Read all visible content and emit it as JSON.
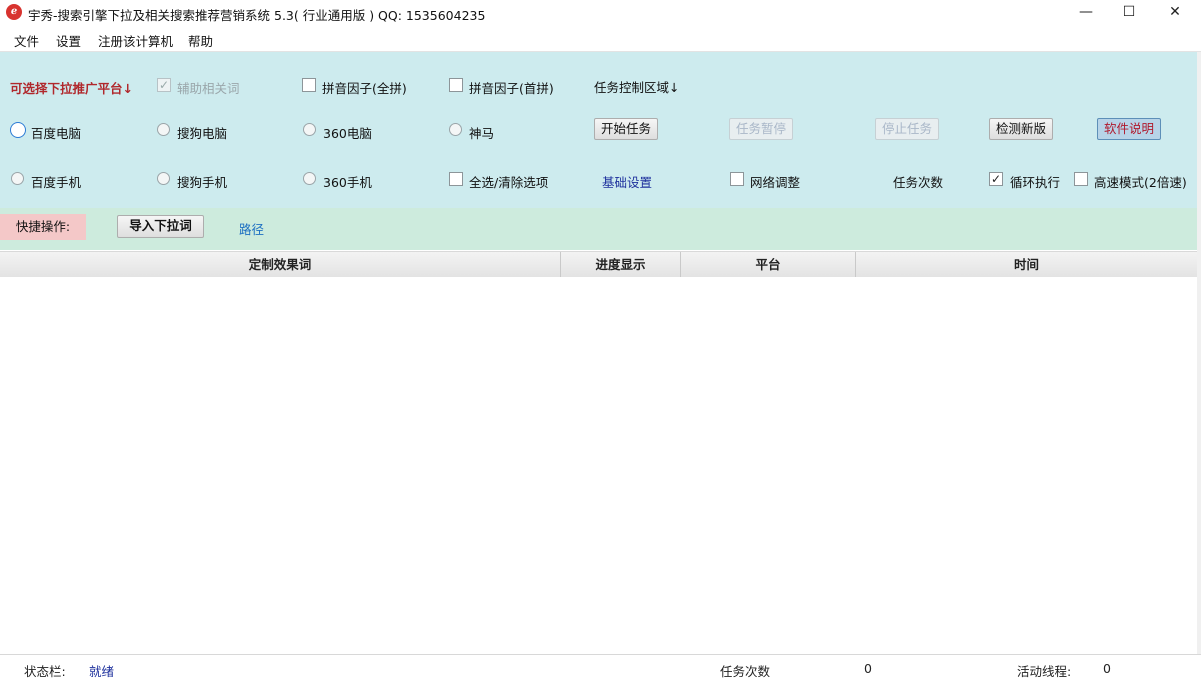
{
  "window": {
    "title": "宇秀-搜索引擎下拉及相关搜索推荐营销系统 5.3( 行业通用版 )    QQ: 1535604235",
    "icon": "app-logo-icon",
    "minimize": "—",
    "maximize": "☐",
    "close": "✕"
  },
  "menu": [
    "文件",
    "设置",
    "注册该计算机",
    "帮助"
  ],
  "options": {
    "platform_label": "可选择下拉推广平台↓",
    "assist_related": "辅助相关词",
    "pinyin_full": "拼音因子(全拼)",
    "pinyin_initial": "拼音因子(首拼)",
    "task_area_label": "任务控制区域↓",
    "radios_row1": [
      "百度电脑",
      "搜狗电脑",
      "360电脑",
      "神马"
    ],
    "radios_row2": [
      "百度手机",
      "搜狗手机",
      "360手机"
    ],
    "select_all": "全选/清除选项",
    "basic_settings": "基础设置",
    "network_adjust": "网络调整",
    "task_count_label": "任务次数",
    "loop_exec": "循环执行",
    "high_speed": "高速模式(2倍速)",
    "buttons": {
      "start": "开始任务",
      "pause": "任务暂停",
      "stop": "停止任务",
      "check_update": "检测新版",
      "manual": "软件说明"
    },
    "colors": {
      "platform_label": "#b0282c",
      "basic_settings": "#1c2f9c"
    }
  },
  "quick": {
    "label": "快捷操作:",
    "import_button": "导入下拉词",
    "path_link": "路径"
  },
  "table": {
    "columns": [
      "定制效果词",
      "进度显示",
      "平台",
      "时间"
    ],
    "rows": []
  },
  "status": {
    "label": "状态栏:",
    "value": "就绪",
    "task_count_label": "任务次数",
    "task_count": "0",
    "threads_label": "活动线程:",
    "threads": "0"
  }
}
